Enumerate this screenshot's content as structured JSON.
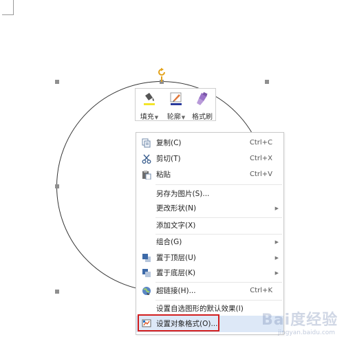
{
  "mini_toolbar": {
    "fill_label": "填充",
    "outline_label": "轮廓",
    "format_painter_label": "格式刷"
  },
  "menu": {
    "items": [
      {
        "label": "复制(C)",
        "shortcut": "Ctrl+C",
        "icon": "copy-icon"
      },
      {
        "label": "剪切(T)",
        "shortcut": "Ctrl+X",
        "icon": "cut-icon"
      },
      {
        "label": "粘贴",
        "shortcut": "Ctrl+V",
        "icon": "paste-icon"
      },
      {
        "label": "另存为图片(S)...",
        "shortcut": ""
      },
      {
        "label": "更改形状(N)",
        "submenu": true
      },
      {
        "label": "添加文字(X)",
        "shortcut": ""
      },
      {
        "label": "组合(G)",
        "submenu": true
      },
      {
        "label": "置于顶层(U)",
        "submenu": true,
        "icon": "bring-to-front-icon"
      },
      {
        "label": "置于底层(K)",
        "submenu": true,
        "icon": "send-to-back-icon"
      },
      {
        "label": "超链接(H)...",
        "shortcut": "Ctrl+K",
        "icon": "hyperlink-icon"
      },
      {
        "label": "设置自选图形的默认效果(I)",
        "shortcut": ""
      },
      {
        "label": "设置对象格式(O)...",
        "shortcut": "",
        "icon": "format-object-icon"
      }
    ]
  },
  "watermark": {
    "text": "Bai度经验",
    "sub": "jingyan.baidu.com"
  },
  "colors": {
    "highlight": "#d21d1d",
    "hover": "#dde8f7",
    "rotate_handle": "#e3a21a"
  }
}
